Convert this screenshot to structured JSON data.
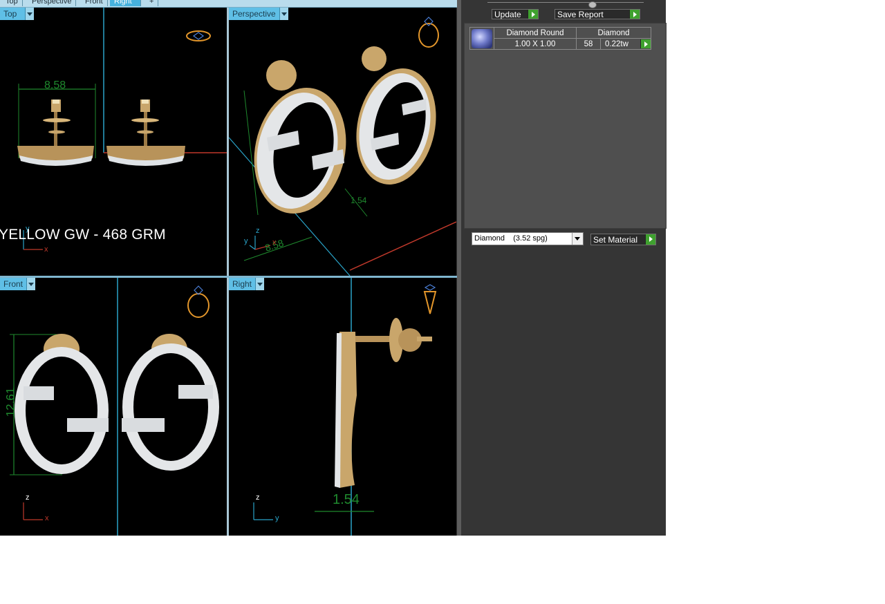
{
  "tabs": [
    {
      "label": "Top"
    },
    {
      "label": "Perspective"
    },
    {
      "label": "Front"
    },
    {
      "label": "Right",
      "active": true
    },
    {
      "label": "+"
    }
  ],
  "viewports": {
    "top": {
      "label": "Top",
      "dimension": "8.58",
      "watermark": "YELLOW GW - 468 GRM",
      "axis_v": "y",
      "axis_h": "x"
    },
    "perspective": {
      "label": "Perspective",
      "dim_front": "8.58",
      "dim_side": "1.54",
      "axis_z": "z",
      "axis_y": "y",
      "axis_x": "x"
    },
    "front": {
      "label": "Front",
      "dimension": "12.61",
      "axis_v": "z",
      "axis_h": "x"
    },
    "right": {
      "label": "Right",
      "dimension": "1.54",
      "axis_v": "z",
      "axis_h": "y"
    }
  },
  "panel": {
    "update_label": "Update",
    "save_report_label": "Save Report",
    "report": {
      "gem_icon": "round-diamond-icon",
      "header": [
        "Diamond Round",
        "Diamond"
      ],
      "size": "1.00 X 1.00",
      "count": "58",
      "weight": "0.22tw"
    },
    "material_select": {
      "value": "Diamond    (3.52 spg)"
    },
    "set_material_label": "Set Material"
  },
  "colors": {
    "tab_active": "#46b2de",
    "viewport_label": "#5fbfe6",
    "gold": "#c9a66b",
    "dimension_green": "#1f8a2e",
    "axis_red": "#c0392b",
    "axis_blue": "#2aa4c9",
    "play_green": "#3fa12f"
  }
}
